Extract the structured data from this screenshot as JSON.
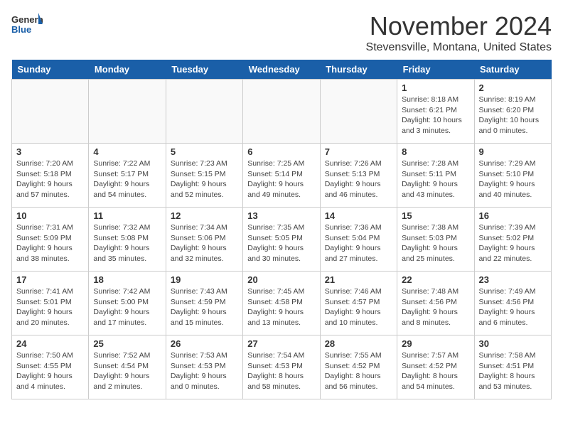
{
  "logo": {
    "line1": "General",
    "line2": "Blue"
  },
  "title": "November 2024",
  "location": "Stevensville, Montana, United States",
  "header": {
    "days": [
      "Sunday",
      "Monday",
      "Tuesday",
      "Wednesday",
      "Thursday",
      "Friday",
      "Saturday"
    ]
  },
  "weeks": [
    [
      {
        "day": "",
        "info": ""
      },
      {
        "day": "",
        "info": ""
      },
      {
        "day": "",
        "info": ""
      },
      {
        "day": "",
        "info": ""
      },
      {
        "day": "",
        "info": ""
      },
      {
        "day": "1",
        "info": "Sunrise: 8:18 AM\nSunset: 6:21 PM\nDaylight: 10 hours\nand 3 minutes."
      },
      {
        "day": "2",
        "info": "Sunrise: 8:19 AM\nSunset: 6:20 PM\nDaylight: 10 hours\nand 0 minutes."
      }
    ],
    [
      {
        "day": "3",
        "info": "Sunrise: 7:20 AM\nSunset: 5:18 PM\nDaylight: 9 hours\nand 57 minutes."
      },
      {
        "day": "4",
        "info": "Sunrise: 7:22 AM\nSunset: 5:17 PM\nDaylight: 9 hours\nand 54 minutes."
      },
      {
        "day": "5",
        "info": "Sunrise: 7:23 AM\nSunset: 5:15 PM\nDaylight: 9 hours\nand 52 minutes."
      },
      {
        "day": "6",
        "info": "Sunrise: 7:25 AM\nSunset: 5:14 PM\nDaylight: 9 hours\nand 49 minutes."
      },
      {
        "day": "7",
        "info": "Sunrise: 7:26 AM\nSunset: 5:13 PM\nDaylight: 9 hours\nand 46 minutes."
      },
      {
        "day": "8",
        "info": "Sunrise: 7:28 AM\nSunset: 5:11 PM\nDaylight: 9 hours\nand 43 minutes."
      },
      {
        "day": "9",
        "info": "Sunrise: 7:29 AM\nSunset: 5:10 PM\nDaylight: 9 hours\nand 40 minutes."
      }
    ],
    [
      {
        "day": "10",
        "info": "Sunrise: 7:31 AM\nSunset: 5:09 PM\nDaylight: 9 hours\nand 38 minutes."
      },
      {
        "day": "11",
        "info": "Sunrise: 7:32 AM\nSunset: 5:08 PM\nDaylight: 9 hours\nand 35 minutes."
      },
      {
        "day": "12",
        "info": "Sunrise: 7:34 AM\nSunset: 5:06 PM\nDaylight: 9 hours\nand 32 minutes."
      },
      {
        "day": "13",
        "info": "Sunrise: 7:35 AM\nSunset: 5:05 PM\nDaylight: 9 hours\nand 30 minutes."
      },
      {
        "day": "14",
        "info": "Sunrise: 7:36 AM\nSunset: 5:04 PM\nDaylight: 9 hours\nand 27 minutes."
      },
      {
        "day": "15",
        "info": "Sunrise: 7:38 AM\nSunset: 5:03 PM\nDaylight: 9 hours\nand 25 minutes."
      },
      {
        "day": "16",
        "info": "Sunrise: 7:39 AM\nSunset: 5:02 PM\nDaylight: 9 hours\nand 22 minutes."
      }
    ],
    [
      {
        "day": "17",
        "info": "Sunrise: 7:41 AM\nSunset: 5:01 PM\nDaylight: 9 hours\nand 20 minutes."
      },
      {
        "day": "18",
        "info": "Sunrise: 7:42 AM\nSunset: 5:00 PM\nDaylight: 9 hours\nand 17 minutes."
      },
      {
        "day": "19",
        "info": "Sunrise: 7:43 AM\nSunset: 4:59 PM\nDaylight: 9 hours\nand 15 minutes."
      },
      {
        "day": "20",
        "info": "Sunrise: 7:45 AM\nSunset: 4:58 PM\nDaylight: 9 hours\nand 13 minutes."
      },
      {
        "day": "21",
        "info": "Sunrise: 7:46 AM\nSunset: 4:57 PM\nDaylight: 9 hours\nand 10 minutes."
      },
      {
        "day": "22",
        "info": "Sunrise: 7:48 AM\nSunset: 4:56 PM\nDaylight: 9 hours\nand 8 minutes."
      },
      {
        "day": "23",
        "info": "Sunrise: 7:49 AM\nSunset: 4:56 PM\nDaylight: 9 hours\nand 6 minutes."
      }
    ],
    [
      {
        "day": "24",
        "info": "Sunrise: 7:50 AM\nSunset: 4:55 PM\nDaylight: 9 hours\nand 4 minutes."
      },
      {
        "day": "25",
        "info": "Sunrise: 7:52 AM\nSunset: 4:54 PM\nDaylight: 9 hours\nand 2 minutes."
      },
      {
        "day": "26",
        "info": "Sunrise: 7:53 AM\nSunset: 4:53 PM\nDaylight: 9 hours\nand 0 minutes."
      },
      {
        "day": "27",
        "info": "Sunrise: 7:54 AM\nSunset: 4:53 PM\nDaylight: 8 hours\nand 58 minutes."
      },
      {
        "day": "28",
        "info": "Sunrise: 7:55 AM\nSunset: 4:52 PM\nDaylight: 8 hours\nand 56 minutes."
      },
      {
        "day": "29",
        "info": "Sunrise: 7:57 AM\nSunset: 4:52 PM\nDaylight: 8 hours\nand 54 minutes."
      },
      {
        "day": "30",
        "info": "Sunrise: 7:58 AM\nSunset: 4:51 PM\nDaylight: 8 hours\nand 53 minutes."
      }
    ]
  ]
}
